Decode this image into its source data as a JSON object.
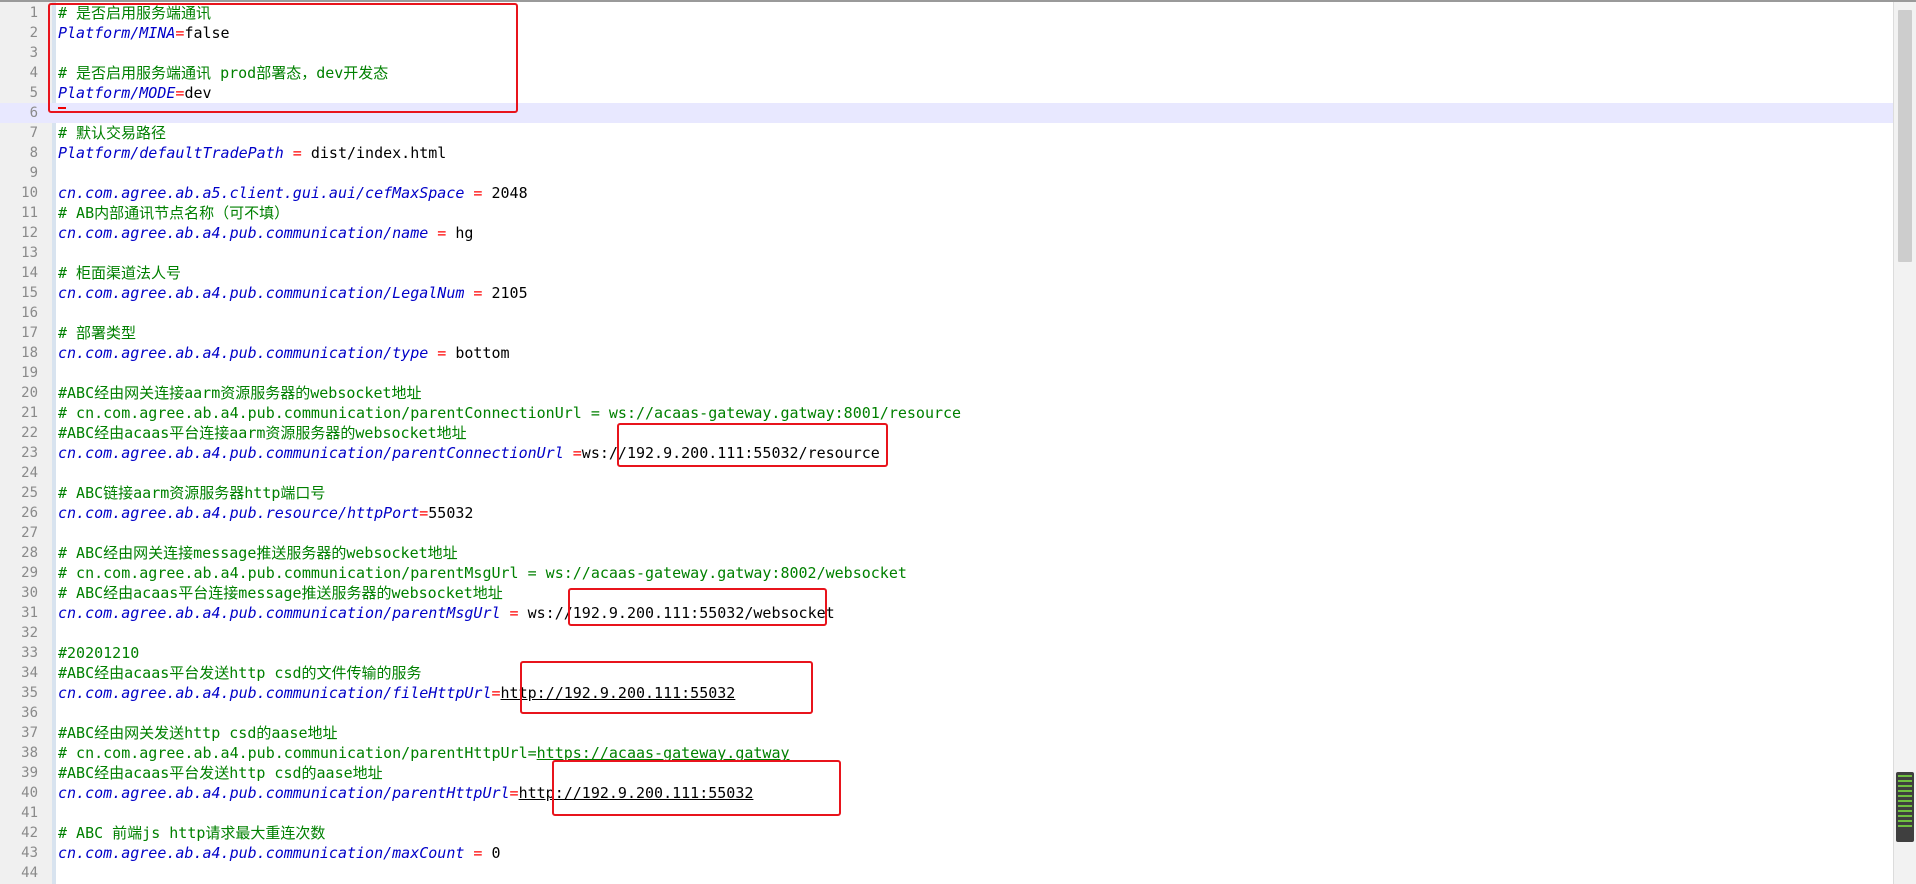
{
  "editor": {
    "lines": [
      {
        "n": "1",
        "parts": [
          {
            "t": "# 是否启用服务端通讯",
            "c": "comment"
          }
        ]
      },
      {
        "n": "2",
        "parts": [
          {
            "t": "Platform/MINA",
            "c": "key"
          },
          {
            "t": "=",
            "c": "eq"
          },
          {
            "t": "false",
            "c": "val"
          }
        ]
      },
      {
        "n": "3",
        "parts": []
      },
      {
        "n": "4",
        "parts": [
          {
            "t": "# 是否启用服务端通讯 prod部署态，dev开发态",
            "c": "comment"
          }
        ]
      },
      {
        "n": "5",
        "parts": [
          {
            "t": "Platform/MODE",
            "c": "key"
          },
          {
            "t": "=",
            "c": "eq"
          },
          {
            "t": "dev",
            "c": "val"
          }
        ]
      },
      {
        "n": "6",
        "parts": [],
        "current": true
      },
      {
        "n": "7",
        "parts": [
          {
            "t": "# 默认交易路径",
            "c": "comment"
          }
        ]
      },
      {
        "n": "8",
        "parts": [
          {
            "t": "Platform/defaultTradePath",
            "c": "key"
          },
          {
            "t": " = ",
            "c": "eq"
          },
          {
            "t": "dist/index.html",
            "c": "val"
          }
        ]
      },
      {
        "n": "9",
        "parts": []
      },
      {
        "n": "10",
        "parts": [
          {
            "t": "cn.com.agree.ab.a5.client.gui.aui/cefMaxSpace",
            "c": "key"
          },
          {
            "t": " = ",
            "c": "eq"
          },
          {
            "t": "2048",
            "c": "val"
          }
        ]
      },
      {
        "n": "11",
        "parts": [
          {
            "t": "# AB内部通讯节点名称（可不填）",
            "c": "comment"
          }
        ]
      },
      {
        "n": "12",
        "parts": [
          {
            "t": "cn.com.agree.ab.a4.pub.communication/name",
            "c": "key"
          },
          {
            "t": " = ",
            "c": "eq"
          },
          {
            "t": "hg",
            "c": "val"
          }
        ]
      },
      {
        "n": "13",
        "parts": []
      },
      {
        "n": "14",
        "parts": [
          {
            "t": "# 柜面渠道法人号",
            "c": "comment"
          }
        ]
      },
      {
        "n": "15",
        "parts": [
          {
            "t": "cn.com.agree.ab.a4.pub.communication/LegalNum",
            "c": "key"
          },
          {
            "t": " = ",
            "c": "eq"
          },
          {
            "t": "2105",
            "c": "val"
          }
        ]
      },
      {
        "n": "16",
        "parts": []
      },
      {
        "n": "17",
        "parts": [
          {
            "t": "# 部署类型",
            "c": "comment"
          }
        ]
      },
      {
        "n": "18",
        "parts": [
          {
            "t": "cn.com.agree.ab.a4.pub.communication/type",
            "c": "key"
          },
          {
            "t": " = ",
            "c": "eq"
          },
          {
            "t": "bottom",
            "c": "val"
          }
        ]
      },
      {
        "n": "19",
        "parts": []
      },
      {
        "n": "20",
        "parts": [
          {
            "t": "#ABC经由网关连接aarm资源服务器的websocket地址",
            "c": "comment"
          }
        ]
      },
      {
        "n": "21",
        "parts": [
          {
            "t": "# cn.com.agree.ab.a4.pub.communication/parentConnectionUrl = ws://acaas-gateway.gatway:8001/resource",
            "c": "comment"
          }
        ]
      },
      {
        "n": "22",
        "parts": [
          {
            "t": "#ABC经由acaas平台连接aarm资源服务器的websocket地址",
            "c": "comment"
          }
        ]
      },
      {
        "n": "23",
        "parts": [
          {
            "t": "cn.com.agree.ab.a4.pub.communication/parentConnectionUrl",
            "c": "key"
          },
          {
            "t": " =",
            "c": "eq"
          },
          {
            "t": "ws://192.9.200.111:55032/resource",
            "c": "val"
          }
        ]
      },
      {
        "n": "24",
        "parts": []
      },
      {
        "n": "25",
        "parts": [
          {
            "t": "# ABC链接aarm资源服务器http端口号",
            "c": "comment"
          }
        ]
      },
      {
        "n": "26",
        "parts": [
          {
            "t": "cn.com.agree.ab.a4.pub.resource/httpPort",
            "c": "key"
          },
          {
            "t": "=",
            "c": "eq"
          },
          {
            "t": "55032",
            "c": "val"
          }
        ]
      },
      {
        "n": "27",
        "parts": []
      },
      {
        "n": "28",
        "parts": [
          {
            "t": "# ABC经由网关连接message推送服务器的websocket地址",
            "c": "comment"
          }
        ]
      },
      {
        "n": "29",
        "parts": [
          {
            "t": "# cn.com.agree.ab.a4.pub.communication/parentMsgUrl = ws://acaas-gateway.gatway:8002/websocket",
            "c": "comment"
          }
        ]
      },
      {
        "n": "30",
        "parts": [
          {
            "t": "# ABC经由acaas平台连接message推送服务器的websocket地址",
            "c": "comment"
          }
        ]
      },
      {
        "n": "31",
        "parts": [
          {
            "t": "cn.com.agree.ab.a4.pub.communication/parentMsgUrl",
            "c": "key"
          },
          {
            "t": " = ",
            "c": "eq"
          },
          {
            "t": "ws://192.9.200.111:55032/websocket",
            "c": "val"
          }
        ]
      },
      {
        "n": "32",
        "parts": []
      },
      {
        "n": "33",
        "parts": [
          {
            "t": "#20201210",
            "c": "comment"
          }
        ]
      },
      {
        "n": "34",
        "parts": [
          {
            "t": "#ABC经由acaas平台发送http csd的文件传输的服务",
            "c": "comment"
          }
        ]
      },
      {
        "n": "35",
        "parts": [
          {
            "t": "cn.com.agree.ab.a4.pub.communication/fileHttpUrl",
            "c": "key"
          },
          {
            "t": "=",
            "c": "eq"
          },
          {
            "t": "http://192.9.200.111:55032",
            "c": "val u"
          }
        ]
      },
      {
        "n": "36",
        "parts": []
      },
      {
        "n": "37",
        "parts": [
          {
            "t": "#ABC经由网关发送http csd的aase地址",
            "c": "comment"
          }
        ]
      },
      {
        "n": "38",
        "parts": [
          {
            "t": "# cn.com.agree.ab.a4.pub.communication/parentHttpUrl=",
            "c": "comment"
          },
          {
            "t": "https://acaas-gateway.gatway",
            "c": "comment u"
          }
        ]
      },
      {
        "n": "39",
        "parts": [
          {
            "t": "#ABC经由acaas平台发送http csd的aase地址",
            "c": "comment"
          }
        ]
      },
      {
        "n": "40",
        "parts": [
          {
            "t": "cn.com.agree.ab.a4.pub.communication/parentHttpUrl",
            "c": "key"
          },
          {
            "t": "=",
            "c": "eq"
          },
          {
            "t": "http://192.9.200.111:55032",
            "c": "val u"
          }
        ]
      },
      {
        "n": "41",
        "parts": []
      },
      {
        "n": "42",
        "parts": [
          {
            "t": "# ABC 前端js http请求最大重连次数",
            "c": "comment"
          }
        ]
      },
      {
        "n": "43",
        "parts": [
          {
            "t": "cn.com.agree.ab.a4.pub.communication/maxCount",
            "c": "key"
          },
          {
            "t": " = ",
            "c": "eq"
          },
          {
            "t": "0",
            "c": "val"
          }
        ]
      },
      {
        "n": "44",
        "parts": []
      }
    ]
  },
  "colors": {
    "comment": "#008000",
    "key": "#0000c8",
    "equals": "#ff0000",
    "highlight_box": "#e8141c",
    "current_line": "#e8e8ff"
  }
}
